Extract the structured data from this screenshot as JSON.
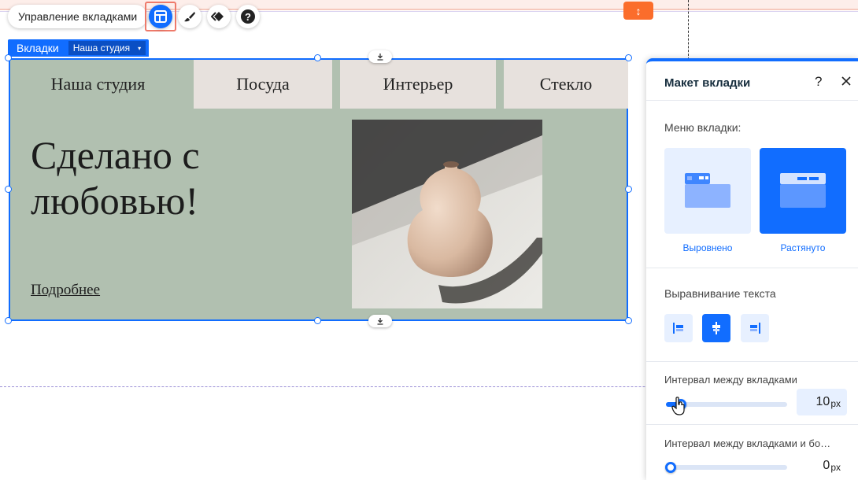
{
  "toolbar": {
    "manage_label": "Управление вкладками",
    "icons": [
      "layout-icon",
      "paint-brush-icon",
      "animation-icon",
      "help-icon"
    ]
  },
  "selection": {
    "component_label": "Вкладки",
    "current_tab": "Наша студия"
  },
  "widget": {
    "tabs": [
      "Наша студия",
      "Посуда",
      "Интерьер",
      "Стекло"
    ],
    "selected_tab_index": 0,
    "headline": "Сделано с любовью!",
    "headline_line1": "Сделано с",
    "headline_line2": "любовью!",
    "link_label": "Подробнее"
  },
  "panel": {
    "title": "Макет вкладки",
    "help_label": "?",
    "menu_label": "Меню вкладки:",
    "layout_options": [
      {
        "label": "Выровнено",
        "selected": false
      },
      {
        "label": "Растянуто",
        "selected": true
      }
    ],
    "text_align_label": "Выравнивание текста",
    "text_align_options": [
      "left-align-icon",
      "center-align-icon",
      "right-align-icon"
    ],
    "text_align_selected": "center",
    "spacing_label": "Интервал между вкладками",
    "spacing_value": "10",
    "spacing_unit": "px",
    "spacing_fraction": 0.08,
    "spacing_content_label": "Интервал между вкладками и бо…",
    "spacing_content_value": "0",
    "spacing_content_unit": "px",
    "spacing_content_fraction": 0.0
  },
  "colors": {
    "accent": "#116dff",
    "tab_background": "#e7e1dd",
    "content_background": "#b1c0b0",
    "orange": "#fb6d2b"
  }
}
